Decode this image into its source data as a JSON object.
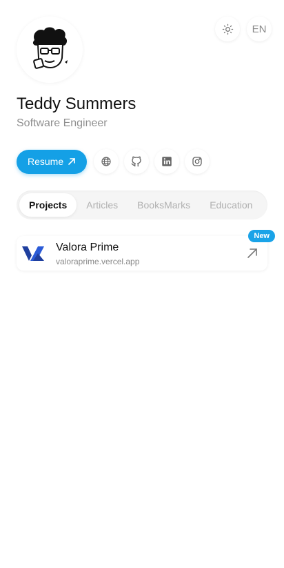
{
  "controls": {
    "theme_icon": "sun-icon",
    "language": "EN"
  },
  "profile": {
    "name": "Teddy Summers",
    "role": "Software Engineer"
  },
  "actions": {
    "resume_label": "Resume",
    "socials": [
      "globe-icon",
      "github-icon",
      "linkedin-icon",
      "instagram-icon"
    ]
  },
  "tabs": [
    {
      "label": "Projects",
      "active": true
    },
    {
      "label": "Articles"
    },
    {
      "label": "BooksMarks"
    },
    {
      "label": "Education"
    }
  ],
  "projects": [
    {
      "title": "Valora Prime",
      "url": "valoraprime.vercel.app",
      "badge": "New"
    }
  ],
  "colors": {
    "accent": "#14a0e6",
    "logo_blue": "#1f3f9e"
  }
}
